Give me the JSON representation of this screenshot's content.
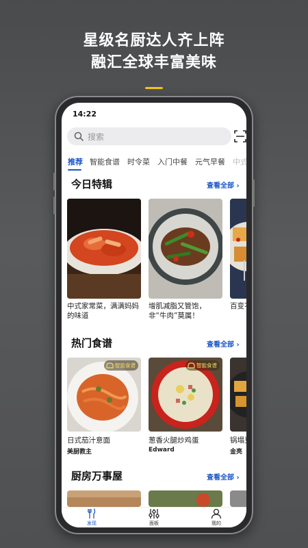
{
  "promo": {
    "headline_line1": "星级名厨达人齐上阵",
    "headline_line2": "融汇全球丰富美味",
    "accent_color": "#f5c518"
  },
  "status_bar": {
    "time": "14:22"
  },
  "search": {
    "placeholder": "搜索",
    "icon": "search-icon",
    "scan_icon": "scan-icon"
  },
  "tabs": [
    {
      "label": "推荐",
      "active": true
    },
    {
      "label": "智能食谱"
    },
    {
      "label": "时令菜"
    },
    {
      "label": "入门中餐"
    },
    {
      "label": "元气早餐"
    },
    {
      "label": "中式"
    }
  ],
  "sections": {
    "today_special": {
      "title": "今日特辑",
      "see_all": "查看全部 ›",
      "cards": [
        {
          "title": "中式家常菜，满满妈妈的味道"
        },
        {
          "title": "增肌减脂又管饱，非“牛肉”莫属！"
        },
        {
          "title": "百变不"
        }
      ]
    },
    "hot_recipes": {
      "title": "热门食谱",
      "see_all": "查看全部 ›",
      "badge": "智能食谱",
      "cards": [
        {
          "title": "日式茄汁意面",
          "author": "美厨教主"
        },
        {
          "title": "葱香火腿炒鸡蛋",
          "author": "Edward"
        },
        {
          "title": "锅塌豆",
          "author": "金亮"
        }
      ]
    },
    "kitchen_tips": {
      "title": "厨房万事屋",
      "see_all": "查看全部 ›"
    }
  },
  "bottom_nav": [
    {
      "label": "发现",
      "icon": "fork-knife-icon",
      "active": true
    },
    {
      "label": "面板",
      "icon": "sliders-icon"
    },
    {
      "label": "我的",
      "icon": "user-icon"
    }
  ],
  "colors": {
    "brand_blue": "#1a55c8",
    "search_bg": "#ececee"
  }
}
